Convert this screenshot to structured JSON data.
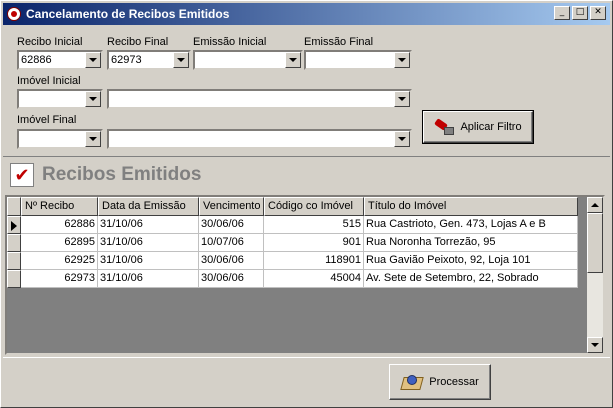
{
  "window": {
    "title": "Cancelamento de Recibos Emitidos",
    "controls": {
      "minimize": "_",
      "maximize": "□",
      "close": "✕"
    }
  },
  "filters": {
    "recibo_inicial": {
      "label": "Recibo Inicial",
      "value": "62886"
    },
    "recibo_final": {
      "label": "Recibo Final",
      "value": "62973"
    },
    "emissao_inicial": {
      "label": "Emissão Inicial",
      "value": ""
    },
    "emissao_final": {
      "label": "Emissão Final",
      "value": ""
    },
    "imovel_inicial": {
      "label": "Imóvel Inicial",
      "code": "",
      "description": ""
    },
    "imovel_final": {
      "label": "Imóvel Final",
      "code": "",
      "description": ""
    },
    "apply_button": {
      "label": "Aplicar Filtro",
      "icon": "flashlight-icon"
    }
  },
  "section": {
    "title": "Recibos Emitidos",
    "icon": "checkmark-icon",
    "check_glyph": "✔"
  },
  "table": {
    "columns": [
      "Nº Recibo",
      "Data da Emissão",
      "Vencimento",
      "Código co Imóvel",
      "Título do Imóvel"
    ],
    "rows": [
      {
        "recibo": "62886",
        "emissao": "31/10/06",
        "vencimento": "30/06/06",
        "codigo": "515",
        "titulo": "Rua Castrioto, Gen. 473, Lojas A e B"
      },
      {
        "recibo": "62895",
        "emissao": "31/10/06",
        "vencimento": "10/07/06",
        "codigo": "901",
        "titulo": "Rua Noronha Torrezão, 95"
      },
      {
        "recibo": "62925",
        "emissao": "31/10/06",
        "vencimento": "30/06/06",
        "codigo": "118901",
        "titulo": "Rua Gavião Peixoto, 92, Loja 101"
      },
      {
        "recibo": "62973",
        "emissao": "31/10/06",
        "vencimento": "30/06/06",
        "codigo": "45004",
        "titulo": "Av. Sete de Setembro, 22, Sobrado"
      }
    ]
  },
  "process_button": {
    "label": "Processar",
    "icon": "process-icon"
  }
}
